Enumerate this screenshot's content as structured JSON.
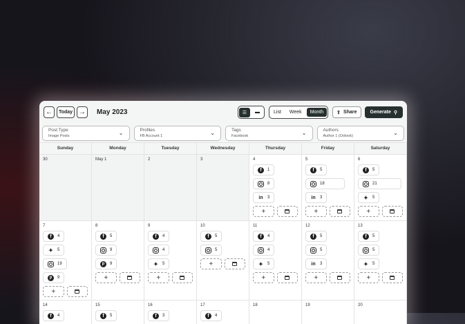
{
  "header": {
    "today": "Today",
    "title": "May 2023",
    "views": [
      "List",
      "Week",
      "Month"
    ],
    "active_view": "Month",
    "share": "Share",
    "generate": "Generate"
  },
  "filters": [
    {
      "label": "Post Type",
      "value": "Image Posts"
    },
    {
      "label": "Profiles",
      "value": "FB Account 1"
    },
    {
      "label": "Tags",
      "value": "Facebook"
    },
    {
      "label": "Authors",
      "value": "Author 1 (Oolook)"
    }
  ],
  "weekdays": [
    "Sunday",
    "Monday",
    "Tuesday",
    "Wednesday",
    "Thursday",
    "Friday",
    "Saturday"
  ],
  "weeks": [
    [
      {
        "d": "30",
        "past": true,
        "chips": []
      },
      {
        "d": "May 1",
        "past": true,
        "chips": []
      },
      {
        "d": "2",
        "past": true,
        "chips": []
      },
      {
        "d": "3",
        "past": true,
        "chips": []
      },
      {
        "d": "4",
        "chips": [
          [
            "facebook",
            "1"
          ],
          [
            "instagram",
            "8"
          ],
          [
            "linkedin",
            "3"
          ]
        ]
      },
      {
        "d": "5",
        "chips": [
          [
            "facebook",
            "5"
          ],
          [
            "instagram",
            "18"
          ],
          [
            "linkedin",
            "3"
          ]
        ]
      },
      {
        "d": "6",
        "chips": [
          [
            "facebook",
            "5"
          ],
          [
            "instagram",
            "21"
          ],
          [
            "twitter",
            "5"
          ]
        ]
      }
    ],
    [
      {
        "d": "7",
        "chips": [
          [
            "facebook",
            "4"
          ],
          [
            "twitter",
            "5"
          ],
          [
            "instagram",
            "19"
          ],
          [
            "pinterest",
            "9"
          ]
        ]
      },
      {
        "d": "8",
        "chips": [
          [
            "facebook",
            "5"
          ],
          [
            "instagram",
            "9"
          ],
          [
            "pinterest",
            "9"
          ]
        ]
      },
      {
        "d": "9",
        "chips": [
          [
            "facebook",
            "4"
          ],
          [
            "instagram",
            "4"
          ],
          [
            "twitter",
            "5"
          ]
        ]
      },
      {
        "d": "10",
        "chips": [
          [
            "facebook",
            "5"
          ],
          [
            "instagram",
            "5"
          ]
        ]
      },
      {
        "d": "11",
        "chips": [
          [
            "facebook",
            "4"
          ],
          [
            "instagram",
            "4"
          ],
          [
            "twitter",
            "5"
          ]
        ]
      },
      {
        "d": "12",
        "chips": [
          [
            "facebook",
            "5"
          ],
          [
            "instagram",
            "5"
          ],
          [
            "linkedin",
            "3"
          ]
        ]
      },
      {
        "d": "13",
        "chips": [
          [
            "facebook",
            "5"
          ],
          [
            "instagram",
            "5"
          ],
          [
            "twitter",
            "5"
          ]
        ]
      }
    ],
    [
      {
        "d": "14",
        "chips": [
          [
            "facebook",
            "4"
          ]
        ]
      },
      {
        "d": "15",
        "chips": [
          [
            "facebook",
            "5"
          ]
        ]
      },
      {
        "d": "16",
        "chips": [
          [
            "facebook",
            "3"
          ]
        ]
      },
      {
        "d": "17",
        "chips": [
          [
            "facebook",
            "4"
          ]
        ]
      },
      {
        "d": "18",
        "chips": []
      },
      {
        "d": "19",
        "chips": []
      },
      {
        "d": "20",
        "chips": []
      }
    ]
  ]
}
